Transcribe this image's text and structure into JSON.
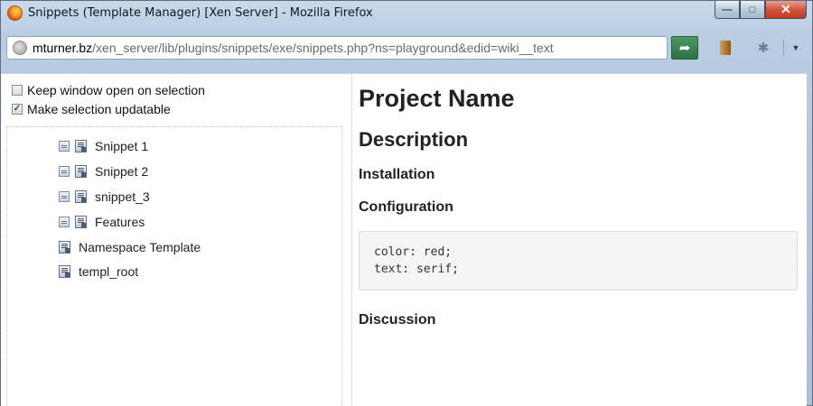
{
  "window": {
    "title": "Snippets (Template Manager) [Xen Server] - Mozilla Firefox",
    "controls": {
      "minimize": "—",
      "maximize": "□",
      "close": "✕"
    }
  },
  "address_bar": {
    "domain": "mturner.bz",
    "path": "/xen_server/lib/plugins/snippets/exe/snippets.php?ns=playground&edid=wiki__text"
  },
  "toolbar": {
    "go_icon": "➦",
    "bug_icon": "✱",
    "menu_icon": "▼"
  },
  "options": [
    {
      "label": "Keep window open on selection",
      "checked": false
    },
    {
      "label": "Make selection updatable",
      "checked": true
    }
  ],
  "tree": {
    "items": [
      {
        "label": "Snippet 1",
        "has_insert_icon": true
      },
      {
        "label": "Snippet 2",
        "has_insert_icon": true
      },
      {
        "label": "snippet_3",
        "has_insert_icon": true
      },
      {
        "label": "Features",
        "has_insert_icon": true
      },
      {
        "label": "Namespace Template",
        "has_insert_icon": false
      },
      {
        "label": "templ_root",
        "has_insert_icon": false
      }
    ]
  },
  "preview": {
    "h1": "Project Name",
    "h2": "Description",
    "installation": "Installation",
    "configuration": "Configuration",
    "code_lines": [
      "color: red;",
      "text: serif;"
    ],
    "discussion": "Discussion"
  },
  "colors": {
    "titlebar": "#c9daea",
    "close_button": "#c23a1f",
    "go_button": "#2f6f45",
    "code_bg": "#f5f5f5"
  }
}
